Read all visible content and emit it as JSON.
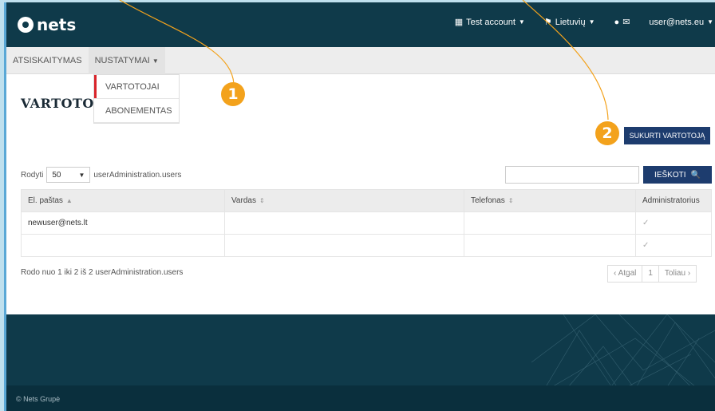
{
  "header": {
    "logo_text": "nets",
    "account_label": "Test account",
    "language_label": "Lietuvių",
    "user_email": "user@nets.eu"
  },
  "subnav": {
    "tabs": [
      {
        "label": "ATSISKAITYMAS"
      },
      {
        "label": "NUSTATYMAI"
      }
    ]
  },
  "dropdown": {
    "items": [
      {
        "label": "VARTOTOJAI"
      },
      {
        "label": "ABONEMENTAS"
      }
    ]
  },
  "page": {
    "title": "VARTOTO",
    "create_button": "SUKURTI VARTOTOJĄ"
  },
  "filter": {
    "show_label": "Rodyti",
    "page_size": "50",
    "suffix": "userAdministration.users",
    "search_value": "",
    "search_button": "IEŠKOTI"
  },
  "table": {
    "columns": [
      "El. paštas",
      "Vardas",
      "Telefonas",
      "Administratorius"
    ],
    "rows": [
      {
        "email": "newuser@nets.lt",
        "name": "",
        "phone": "",
        "admin": "✓"
      },
      {
        "email": "",
        "name": "",
        "phone": "",
        "admin": "✓"
      }
    ]
  },
  "summary": "Rodo nuo 1 iki 2 iš 2 userAdministration.users",
  "pager": {
    "prev": "Atgal",
    "page": "1",
    "next": "Toliau"
  },
  "footer": {
    "copyright": "© Nets Grupė"
  },
  "callouts": {
    "one": "1",
    "two": "2"
  },
  "colors": {
    "accent": "#1d3c6e",
    "header_bg": "#0f3a4a",
    "callout": "#f3a21c",
    "selected_bar": "#d9252b"
  }
}
